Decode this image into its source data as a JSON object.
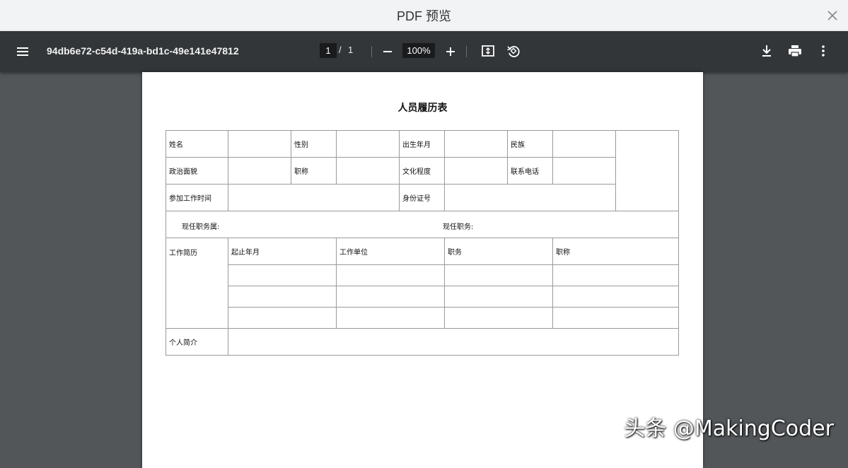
{
  "dialog": {
    "title": "PDF 预览"
  },
  "toolbar": {
    "filename": "94db6e72-c54d-419a-bd1c-49e141e47812",
    "page_current": "1",
    "page_sep": "/",
    "page_total": "1",
    "zoom": "100%"
  },
  "icons": [
    "menu-icon",
    "minus-icon",
    "plus-icon",
    "fit-page-icon",
    "rotate-icon",
    "download-icon",
    "print-icon",
    "more-vert-icon",
    "close-icon"
  ],
  "document": {
    "title": "人员履历表",
    "labels": {
      "name": "姓名",
      "gender": "性别",
      "birth": "出生年月",
      "ethnicity": "民族",
      "political": "政治面貌",
      "prof_title": "职称",
      "education": "文化程度",
      "phone": "联系电话",
      "work_start": "参加工作时间",
      "id_number": "身份证号",
      "current_dept": "现任职务属:",
      "current_post": "现任职务:",
      "work_history": "工作简历",
      "period": "起止年月",
      "employer": "工作单位",
      "duty": "职务",
      "job_title": "职称",
      "intro": "个人简介"
    }
  },
  "watermark": "头条 @MakingCoder",
  "colors": {
    "toolbar_bg": "#323639",
    "viewer_bg": "#525659",
    "titlebar_bg": "#f2f3f5"
  }
}
